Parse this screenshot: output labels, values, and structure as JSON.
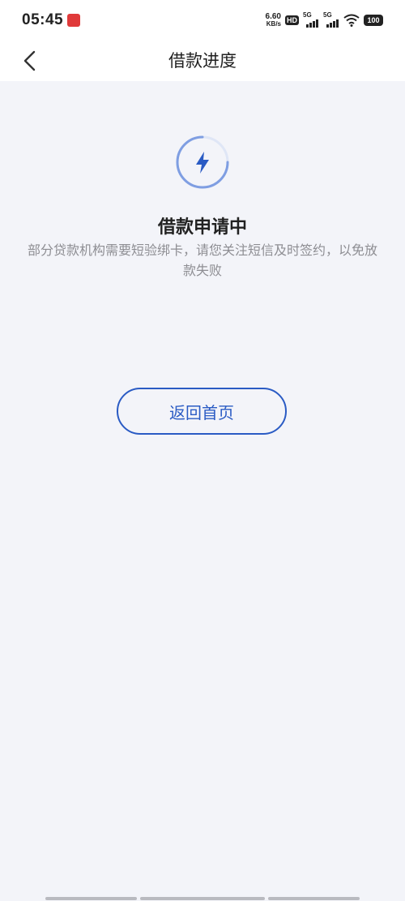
{
  "status_bar": {
    "time": "05:45",
    "net_speed_value": "6.60",
    "net_speed_unit": "KB/s",
    "hd_label": "HD",
    "sim1_label": "5G",
    "sim2_label": "5G",
    "battery": "100"
  },
  "nav": {
    "title": "借款进度",
    "back_icon": "chevron-left-icon"
  },
  "status": {
    "icon": "lightning-bolt-icon",
    "title": "借款申请中",
    "description": "部分贷款机构需要短验绑卡，请您关注短信及时签约，以免放款失败"
  },
  "actions": {
    "home_label": "返回首页"
  },
  "colors": {
    "accent": "#2a5bc4",
    "background": "#f3f4f9",
    "text_secondary": "#8e8e93"
  }
}
